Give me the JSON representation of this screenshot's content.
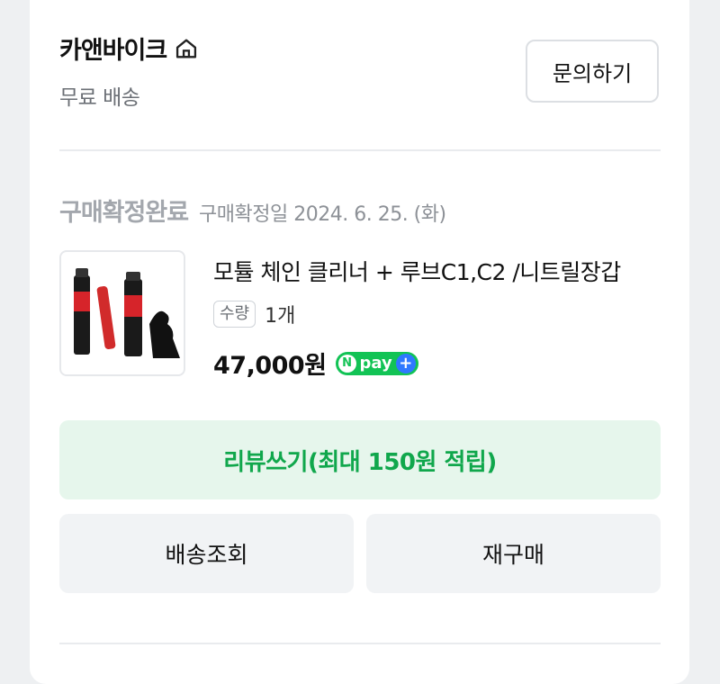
{
  "store": {
    "name": "카앤바이크",
    "shipping": "무료 배송",
    "inquiry_label": "문의하기"
  },
  "order": {
    "status": "구매확정완료",
    "confirm_date": "구매확정일 2024. 6. 25. (화)",
    "product_title": "모튤 체인 클리너 + 루브C1,C2 /니트릴장갑",
    "quantity_label": "수량",
    "quantity_value": "1개",
    "price": "47,000원",
    "npay_text": "pay"
  },
  "actions": {
    "review_label": "리뷰쓰기(최대 150원 적립)",
    "tracking_label": "배송조회",
    "rebuy_label": "재구매"
  },
  "colors": {
    "accent_green": "#10a74c",
    "review_bg": "#e6f6ec",
    "npay_green": "#12c355",
    "npay_blue": "#2f78ff"
  }
}
